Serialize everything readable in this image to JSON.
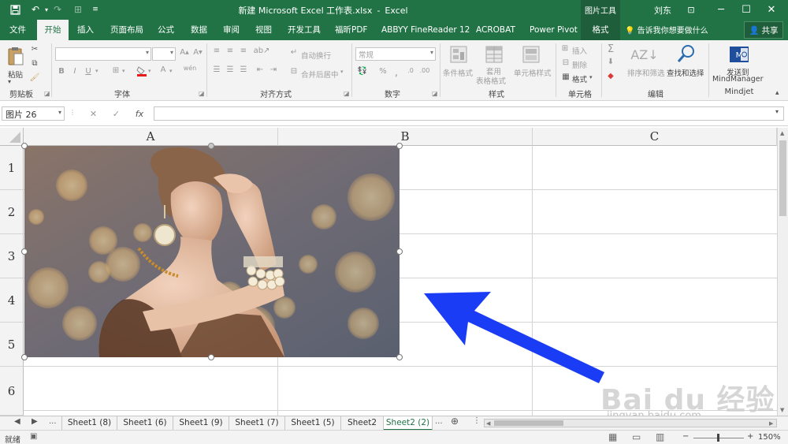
{
  "window": {
    "title_doc": "新建 Microsoft Excel 工作表.xlsx",
    "title_sep": "-",
    "title_app": "Excel",
    "context_tools": "图片工具",
    "user": "刘东"
  },
  "tabs": [
    "文件",
    "开始",
    "插入",
    "页面布局",
    "公式",
    "数据",
    "审阅",
    "视图",
    "开发工具",
    "福昕PDF",
    "ABBYY FineReader 12",
    "ACROBAT",
    "Power Pivot",
    "格式"
  ],
  "active_tab": "开始",
  "tell_me": "告诉我你想要做什么",
  "share": "共享",
  "ribbon": {
    "paste": "粘贴",
    "groups": [
      "剪贴板",
      "字体",
      "对齐方式",
      "数字",
      "样式",
      "单元格",
      "编辑",
      "Mindjet"
    ],
    "wrap_text": "自动换行",
    "merge_center": "合并后居中",
    "number_format": "常规",
    "percent": "%",
    "cond_format": "条件格式",
    "table_format_1": "套用",
    "table_format_2": "表格格式",
    "cell_styles": "单元格样式",
    "insert": "插入",
    "delete": "删除",
    "format": "格式",
    "sort_filter": "排序和筛选",
    "find_select": "查找和选择",
    "send_to_1": "发送到",
    "send_to_2": "MindManager",
    "bold": "B",
    "italic": "I",
    "underline": "U"
  },
  "formula_bar": {
    "name_box": "图片 26",
    "cancel": "✕",
    "enter": "✓",
    "fx": "fx"
  },
  "grid": {
    "columns": [
      "A",
      "B",
      "C"
    ],
    "rows": [
      "1",
      "2",
      "3",
      "4",
      "5",
      "6"
    ]
  },
  "sheets": [
    "Sheet1 (8)",
    "Sheet1 (6)",
    "Sheet1 (9)",
    "Sheet1 (7)",
    "Sheet1 (5)",
    "Sheet2",
    "Sheet2 (2)"
  ],
  "active_sheet": "Sheet2 (2)",
  "sheet_more": "...",
  "status": {
    "ready": "就绪",
    "zoom": "150%",
    "zoom_minus": "−",
    "zoom_plus": "+"
  },
  "watermark": {
    "logo": "Bai du 经验",
    "url": "jingyan.baidu.com"
  },
  "colors": {
    "excel_green": "#217346",
    "arrow_blue": "#1a3cf5"
  }
}
